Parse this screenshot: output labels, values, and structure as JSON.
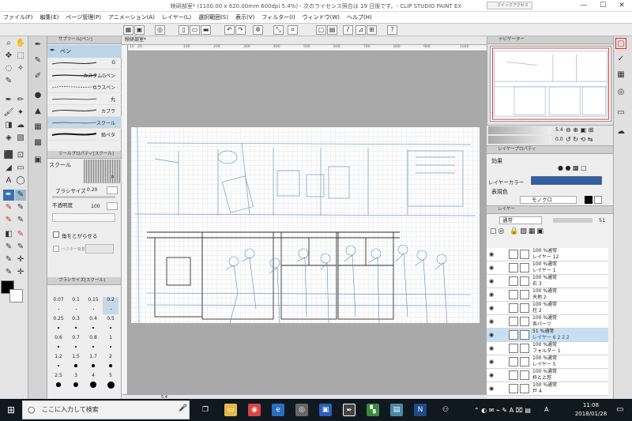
{
  "window": {
    "title": "映研部室* (1100.00 x 620.00mm 600dpi 5.4%) - 次のライセンス照合は 19 日後です。- CLIP STUDIO PAINT EX",
    "quick_access": "クイックアクセス",
    "minimize": "—",
    "maximize": "☐",
    "close": "✕"
  },
  "menu": [
    "ファイル(F)",
    "編集(E)",
    "ページ管理(P)",
    "アニメーション(A)",
    "レイヤー(L)",
    "選択範囲(S)",
    "表示(V)",
    "フィルター(I)",
    "ウィンドウ(W)",
    "ヘルプ(H)"
  ],
  "subtool_panel": {
    "header": "サブツール[ペン]",
    "group": "ペン",
    "brushes": [
      "G",
      "カスタムGペン",
      "Gラスペン",
      "丸",
      "カブラ",
      "スクール",
      "鉛ペタ"
    ],
    "selected_brush": "スクール"
  },
  "tool_props": {
    "header": "ツールプロパティ[スクール]",
    "name": "スクール",
    "brush_size_label": "ブラシサイズ",
    "brush_size_value": "0.20",
    "opacity_label": "不透明度",
    "opacity_value": "100",
    "corner_label": "角をとがらせる",
    "vector_label": "ベクター吸着"
  },
  "brush_size_panel": {
    "header": "ブラシサイズ[スクール]",
    "sizes": [
      "0.07",
      "0.1",
      "0.15",
      "0.2",
      "0.25",
      "0.3",
      "0.4",
      "0.5",
      "0.6",
      "0.7",
      "0.8",
      "1",
      "1.2",
      "1.5",
      "1.7",
      "2",
      "2.5",
      "3",
      "4",
      "5"
    ],
    "selected": "0.2"
  },
  "document": {
    "tab": "映研部室*",
    "zoom": "5.4",
    "ruler_ticks": [
      "10",
      "20",
      "100",
      "200",
      "300",
      "400",
      "500",
      "600",
      "700",
      "800",
      "900",
      "1000",
      "1040"
    ]
  },
  "navigator": {
    "header": "ナビゲーター",
    "zoom": "5.4",
    "rotate": "0.0"
  },
  "layer_props": {
    "header": "レイヤープロパティ",
    "effect_label": "効果",
    "layer_color_label": "レイヤーカラー",
    "expression_label": "表現色",
    "expression_value": "モノクロ"
  },
  "layers_panel": {
    "header": "レイヤー",
    "blend": "通常",
    "opacity": "51",
    "layers": [
      {
        "line1": "100 %通常",
        "line2": "レイヤー 12",
        "selected": false
      },
      {
        "line1": "100 %通常",
        "line2": "レイヤー 1",
        "selected": false
      },
      {
        "line1": "100 %通常",
        "line2": "右 3",
        "selected": false
      },
      {
        "line1": "100 %通常",
        "line2": "天地 2",
        "selected": false
      },
      {
        "line1": "100 %通常",
        "line2": "柱 2",
        "selected": false
      },
      {
        "line1": "100 %通常",
        "line2": "各パーツ",
        "selected": false
      },
      {
        "line1": "51 %通常",
        "line2": "レイヤー 6 2 2 2",
        "selected": true
      },
      {
        "line1": "100 %通常",
        "line2": "フォルダー 1",
        "selected": false
      },
      {
        "line1": "100 %通常",
        "line2": "レイヤー 5",
        "selected": false
      },
      {
        "line1": "100 %通常",
        "line2": "枠と上窓",
        "selected": false
      },
      {
        "line1": "100 %通常",
        "line2": "戸 4",
        "selected": false
      }
    ]
  },
  "taskbar": {
    "search_placeholder": "ここに入力して検索",
    "time": "11:08",
    "date": "2018/01/28",
    "ime": "A"
  },
  "colors": {
    "accent": "#3a6fb3",
    "layer_color": "#2f5fa8",
    "selection": "#c8dff2",
    "taskbar": "#101820"
  }
}
